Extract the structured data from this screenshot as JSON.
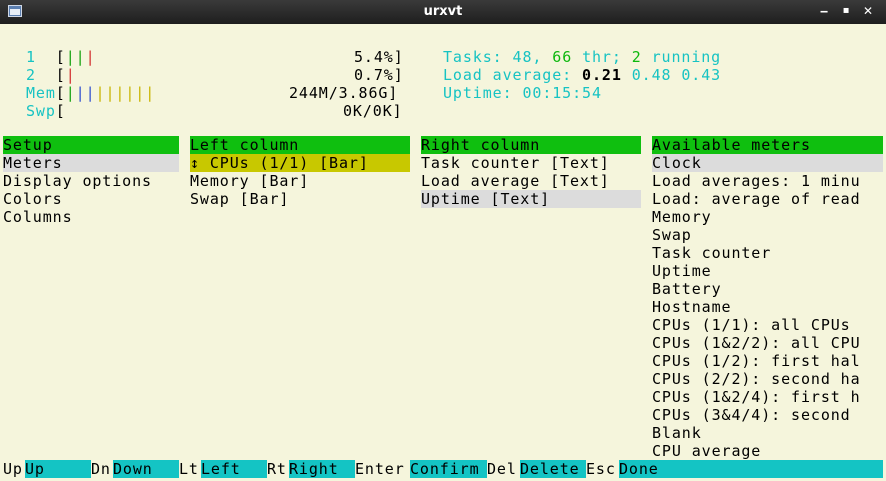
{
  "window": {
    "title": "urxvt"
  },
  "meters": {
    "cpu1": {
      "label": "1",
      "bar": "|||",
      "value": "5.4%]"
    },
    "cpu2": {
      "label": "2",
      "bar": "|",
      "value": "0.7%]"
    },
    "mem": {
      "label": "Mem",
      "bar_blue": "||||",
      "bar_yellow": "|||||",
      "value": "244M/3.86G]"
    },
    "swp": {
      "label": "Swp",
      "value": "0K/0K]"
    },
    "tasks": {
      "label": "Tasks: ",
      "count": "48",
      "sep": ", ",
      "threads": "66",
      "thr_label": " thr; ",
      "running": "2",
      "running_label": " running"
    },
    "load": {
      "label": "Load average: ",
      "v1": "0.21",
      "v2": "0.48",
      "v3": "0.43"
    },
    "uptime": {
      "label": "Uptime: ",
      "value": "00:15:54"
    }
  },
  "setup": {
    "header": "Setup",
    "items": [
      "Meters",
      "Display options",
      "Colors",
      "Columns"
    ]
  },
  "left_column": {
    "header": "Left column",
    "items": [
      "↕ CPUs (1/1) [Bar]",
      "Memory [Bar]",
      "Swap [Bar]"
    ]
  },
  "right_column": {
    "header": "Right column",
    "items": [
      "Task counter [Text]",
      "Load average [Text]",
      "Uptime [Text]"
    ]
  },
  "available": {
    "header": "Available meters",
    "items": [
      "Clock",
      "Load averages: 1 minu",
      "Load: average of read",
      "Memory",
      "Swap",
      "Task counter",
      "Uptime",
      "Battery",
      "Hostname",
      "CPUs (1/1): all CPUs",
      "CPUs (1&2/2): all CPU",
      "CPUs (1/2): first hal",
      "CPUs (2/2): second ha",
      "CPUs (1&2/4): first h",
      "CPUs (3&4/4): second",
      "Blank",
      "CPU average"
    ]
  },
  "footer": [
    {
      "key": "Up",
      "action": "Up"
    },
    {
      "key": "Dn",
      "action": "Down"
    },
    {
      "key": "Lt",
      "action": "Left"
    },
    {
      "key": "Rt",
      "action": "Right"
    },
    {
      "key": "Enter",
      "action": "Confirm"
    },
    {
      "key": "Del",
      "action": "Delete"
    },
    {
      "key": "Esc",
      "action": "Done"
    }
  ],
  "colors": {
    "header_green": "#0fbf0f",
    "function_bar": "#14c4c4",
    "selected_yellow": "#c8c800",
    "selected_grey": "#dcdcdc",
    "background": "#f5f5dc"
  }
}
